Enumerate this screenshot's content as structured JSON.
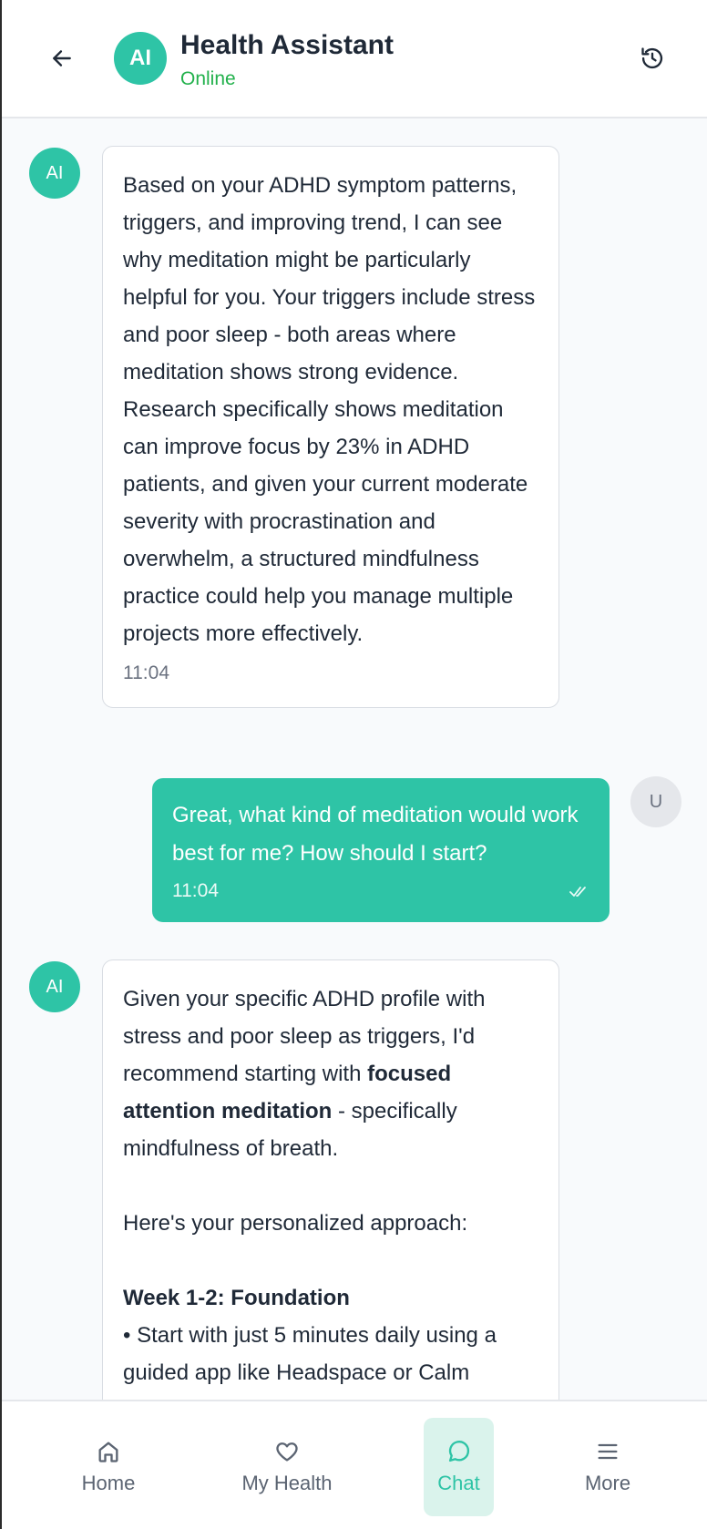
{
  "header": {
    "avatar_initials": "AI",
    "title": "Health Assistant",
    "status": "Online",
    "status_color": "#22b14c",
    "back_icon": "arrow-left-icon",
    "history_icon": "history-icon"
  },
  "messages": [
    {
      "sender": "ai",
      "avatar": "AI",
      "text": "Based on your ADHD symptom patterns, triggers, and improving trend, I can see why meditation might be particularly helpful for you. Your triggers include stress and poor sleep - both areas where meditation shows strong evidence. Research specifically shows meditation can improve focus by 23% in ADHD patients, and given your current moderate severity with procrastination and overwhelm, a structured mindfulness practice could help you manage multiple projects more effectively.",
      "time": "11:04"
    },
    {
      "sender": "user",
      "avatar": "U",
      "text": "Great, what kind of meditation would work best for me? How should I start?",
      "time": "11:04",
      "read_icon": "double-check-icon"
    },
    {
      "sender": "ai",
      "avatar": "AI",
      "intro_before_bold": "Given your specific ADHD profile with stress and poor sleep as triggers, I'd recommend starting with ",
      "intro_bold": "focused attention meditation",
      "intro_after_bold": " - specifically mindfulness of breath.",
      "approach": "Here's your personalized approach:",
      "week_heading": "Week 1-2: Foundation",
      "bullet_1": "• Start with just 5 minutes daily using a guided app like Headspace or Calm"
    }
  ],
  "nav": {
    "items": [
      {
        "label": "Home",
        "icon": "home-icon"
      },
      {
        "label": "My Health",
        "icon": "heart-icon"
      },
      {
        "label": "Chat",
        "icon": "chat-bubble-icon",
        "active": true
      },
      {
        "label": "More",
        "icon": "menu-icon"
      }
    ]
  },
  "colors": {
    "accent": "#2ec4a6",
    "active_nav_bg": "#daf3ec",
    "inactive_nav": "#5b6472"
  }
}
